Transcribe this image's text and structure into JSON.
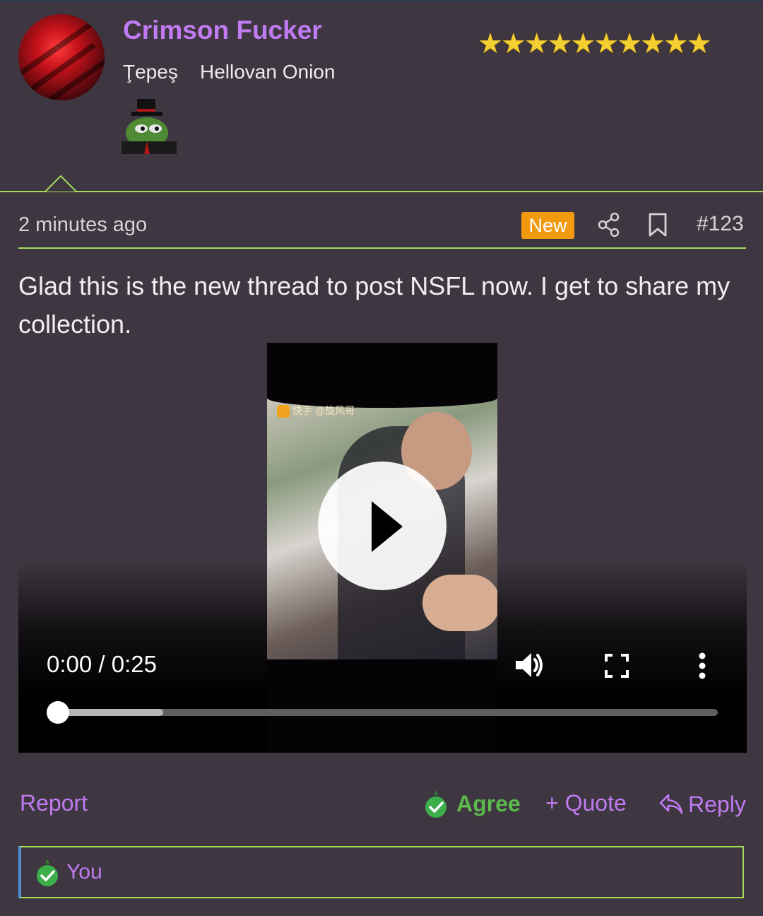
{
  "user": {
    "name": "Crimson Fucker",
    "titles": [
      "Ţepeş",
      "Hellovan Onion"
    ],
    "star_rating": 10,
    "colors": {
      "name": "#c07bf2",
      "stars": "#f3cf32"
    }
  },
  "post": {
    "timestamp": "2 minutes ago",
    "new_label": "New",
    "number": "#123",
    "message": "Glad this is the new thread to post NSFL now. I get to share my collection."
  },
  "video": {
    "time": "0:00 / 0:25",
    "watermark": "快手 @旋风哥",
    "buffered_fraction": 0.16,
    "played_fraction": 0
  },
  "actions": {
    "report": "Report",
    "agree": "Agree",
    "quote": "+ Quote",
    "reply": "Reply"
  },
  "reactions": {
    "text": "You"
  },
  "colors": {
    "accent_line": "#a4dc5a",
    "new_badge": "#f29a0d",
    "agree": "#5cb94e",
    "link": "#c07bf2"
  }
}
